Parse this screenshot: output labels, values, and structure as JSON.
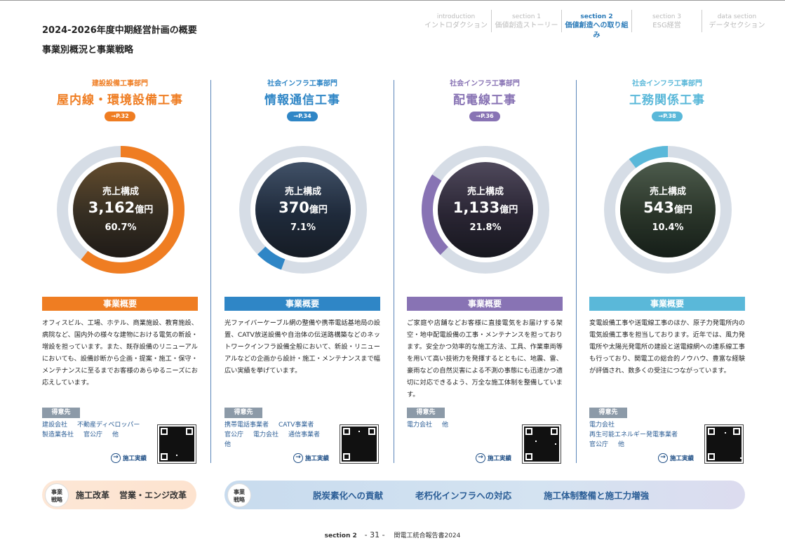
{
  "header": {
    "title": "2024-2026年度中期経営計画の概要",
    "subtitle": "事業別概況と事業戦略"
  },
  "nav": [
    {
      "en": "introduction",
      "jp": "イントロダクション",
      "active": false
    },
    {
      "en": "section 1",
      "jp": "価値創造ストーリー",
      "active": false
    },
    {
      "en": "section 2",
      "jp": "価値創造への取り組み",
      "active": true
    },
    {
      "en": "section 3",
      "jp": "ESG経営",
      "active": false
    },
    {
      "en": "data section",
      "jp": "データセクション",
      "active": false
    }
  ],
  "colors": {
    "orange": "#ef7d22",
    "blue": "#2f86c6",
    "purple": "#8873b4",
    "cyan": "#5ab8d9",
    "ring_bg": "#d6dde6"
  },
  "segments": [
    {
      "dept": "建設設備工事部門",
      "name": "屋内線・環境設備工事",
      "page_ref": "→P.32",
      "sales_label": "売上構成",
      "sales_value": "3,162",
      "sales_unit": "億円",
      "share_pct": "60.7%",
      "share": 0.607,
      "overview_label": "事業概要",
      "overview": "オフィスビル、工場、ホテル、商業施設、教育施設、病院など、国内外の様々な建物における電気の新設・増設を担っています。また、既存設備のリニューアルにおいても、設備診断から企画・提案・施工・保守・メンテナンスに至るまでお客様のあらゆるニーズにお応えしています。",
      "clients_label": "得意先",
      "clients": [
        "建設会社",
        "不動産ディベロッパー",
        "製造業各社",
        "官公庁",
        "他"
      ],
      "works_label": "施工実績",
      "color": "#ef7d22",
      "icon": "building-photo"
    },
    {
      "dept": "社会インフラ工事部門",
      "name": "情報通信工事",
      "page_ref": "→P.34",
      "sales_label": "売上構成",
      "sales_value": "370",
      "sales_unit": "億円",
      "share_pct": "7.1%",
      "share": 0.071,
      "overview_label": "事業概要",
      "overview": "光ファイバーケーブル網の整備や携帯電話基地局の設置、CATV放送設備や自治体の伝送路構築などのネットワークインフラ設備全般において、新設・リニューアルなどの企画から設計・施工・メンテナンスまで幅広い実績を挙げています。",
      "clients_label": "得意先",
      "clients": [
        "携帯電話事業者",
        "CATV事業者",
        "官公庁",
        "電力会社",
        "通信事業者",
        "他"
      ],
      "works_label": "施工実績",
      "color": "#2f86c6",
      "icon": "worker-photo"
    },
    {
      "dept": "社会インフラ工事部門",
      "name": "配電線工事",
      "page_ref": "→P.36",
      "sales_label": "売上構成",
      "sales_value": "1,133",
      "sales_unit": "億円",
      "share_pct": "21.8%",
      "share": 0.218,
      "overview_label": "事業概要",
      "overview": "ご家庭や店舗などお客様に直接電気をお届けする架空・地中配電設備の工事・メンテナンスを担っております。安全かつ効率的な施工方法、工具、作業車両等を用いて高い技術力を発揮するとともに、地震、雷、豪雨などの自然災害による不測の事態にも迅速かつ適切に対応できるよう、万全な施工体制を整備しています。",
      "clients_label": "得意先",
      "clients": [
        "電力会社",
        "他"
      ],
      "works_label": "施工実績",
      "color": "#8873b4",
      "icon": "utility-pole-photo"
    },
    {
      "dept": "社会インフラ工事部門",
      "name": "工務関係工事",
      "page_ref": "→P.38",
      "sales_label": "売上構成",
      "sales_value": "543",
      "sales_unit": "億円",
      "share_pct": "10.4%",
      "share": 0.104,
      "overview_label": "事業概要",
      "overview": "変電設備工事や送電線工事のほか、原子力発電所内の電気設備工事を担当しております。近年では、風力発電所や太陽光発電所の建設と送電線網への連系線工事も行っており、関電工の総合的ノウハウ、豊富な経験が評価され、数多くの受注につながっています。",
      "clients_label": "得意先",
      "clients": [
        "電力会社",
        "再生可能エネルギー発電事業者",
        "官公庁",
        "他"
      ],
      "works_label": "施工実績",
      "color": "#5ab8d9",
      "icon": "wind-turbine-photo"
    }
  ],
  "strategy": {
    "badge": "事業\n戦略",
    "left_items": [
      "施工改革",
      "営業・エンジ改革"
    ],
    "right_items": [
      "脱炭素化への貢献",
      "老朽化インフラへの対応",
      "施工体制整備と施工力増強"
    ]
  },
  "footer": {
    "section": "section 2",
    "page": "- 31 -",
    "report": "関電工統合報告書2024"
  }
}
